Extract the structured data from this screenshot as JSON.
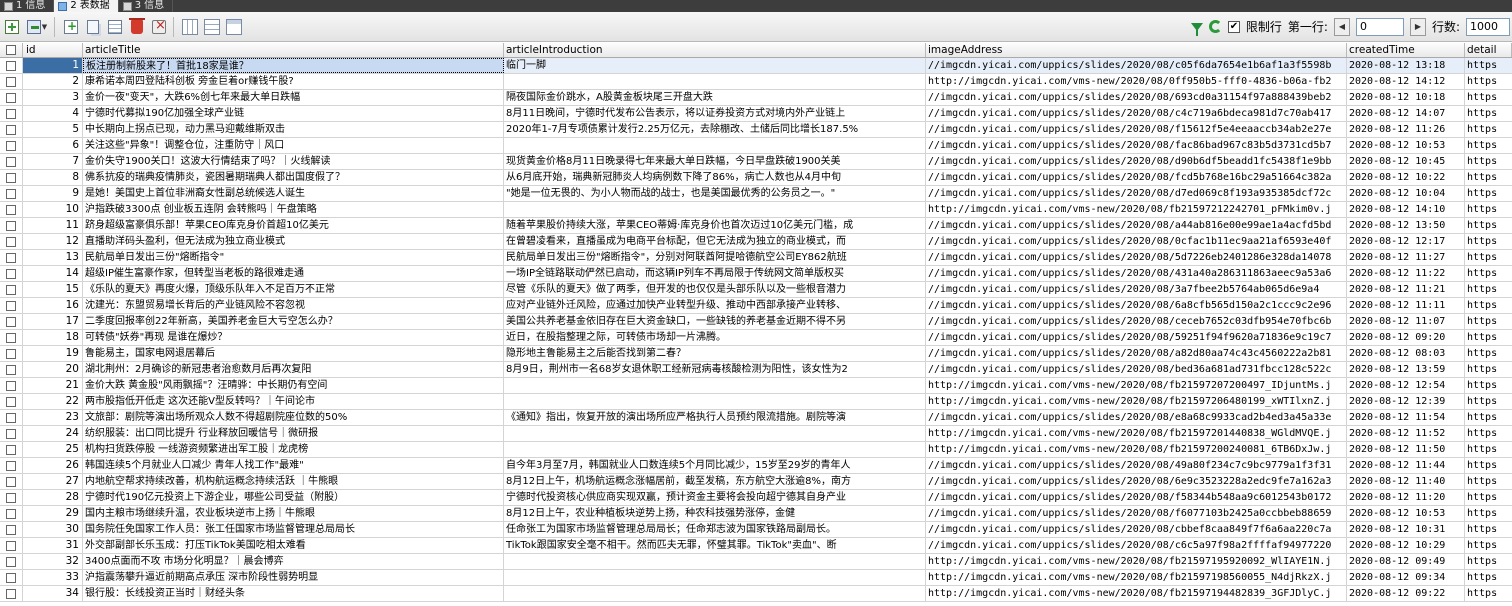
{
  "tabs": [
    {
      "num": "1",
      "label": "信息",
      "active": false
    },
    {
      "num": "2",
      "label": "表数据",
      "active": true
    },
    {
      "num": "3",
      "label": "信息",
      "active": false
    }
  ],
  "toolbar": {
    "limit_label": "限制行",
    "first_row_label": "第一行:",
    "first_row_value": "0",
    "rows_label": "行数:",
    "rows_value": "1000"
  },
  "grid": {
    "columns": [
      "id",
      "articleTitle",
      "articleIntroduction",
      "imageAddress",
      "createdTime",
      "detail"
    ],
    "rows": [
      [
        "1",
        "板注册制新股来了！首批18家是谁？",
        "临门一脚",
        "//imgcdn.yicai.com/uppics/slides/2020/08/c05f6da7654e1b6af1a3f5598b",
        "2020-08-12 13:18",
        "https"
      ],
      [
        "2",
        "康希诺本周四登陆科创板 旁金巨着or赚钱午股?",
        "",
        "http://imgcdn.yicai.com/vms-new/2020/08/0ff950b5-fff0-4836-b06a-fb2",
        "2020-08-12 14:12",
        "https"
      ],
      [
        "3",
        "金价一夜\"变天\"，大跌6%创七年来最大单日跌幅",
        "隔夜国际金价跳水，A股黄金板块尾三开盘大跌",
        "//imgcdn.yicai.com/uppics/slides/2020/08/693cd0a31154f97a888439beb2",
        "2020-08-12 10:18",
        "https"
      ],
      [
        "4",
        "宁德时代募拟190亿加强全球产业链",
        "8月11日晚间，宁德时代发布公告表示，将以证券投资方式对境内外产业链上",
        "//imgcdn.yicai.com/uppics/slides/2020/08/c4c719a6bdeca981d7c70ab417",
        "2020-08-12 14:07",
        "https"
      ],
      [
        "5",
        "中长期向上拐点已现，动力黑马迎戴维斯双击",
        "2020年1-7月专项债累计发行2.25万亿元，去除棚改、土储后同比增长187.5%",
        "//imgcdn.yicai.com/uppics/slides/2020/08/f15612f5e4eeaaccb34ab2e27e",
        "2020-08-12 11:26",
        "https"
      ],
      [
        "6",
        "关注这些\"异象\"！调整仓位，注重防守｜风口",
        "",
        "//imgcdn.yicai.com/uppics/slides/2020/08/fac86bad967c83b5d3731cd5b7",
        "2020-08-12 10:53",
        "https"
      ],
      [
        "7",
        "金价失守1900关口！这波大行情结束了吗？｜火线解读",
        "现货黄金价格8月11日晚录得七年来最大单日跌幅，今日早盘跌破1900关美",
        "//imgcdn.yicai.com/uppics/slides/2020/08/d90b6df5beadd1fc5438f1e9bb",
        "2020-08-12 10:45",
        "https"
      ],
      [
        "8",
        "佛系抗疫的瑞典疫情肺炎，瓷困暑期瑞典人都出国度假了？",
        "从6月底开始，瑞典新冠肺炎人均病例数下降了86%，病亡人数也从4月中旬",
        "//imgcdn.yicai.com/uppics/slides/2020/08/fcd5b768e16bc29a51664c382a",
        "2020-08-12 10:22",
        "https"
      ],
      [
        "9",
        "是她！美国史上首位非洲裔女性副总统候选人诞生",
        "\"她是一位无畏的、为小人物而战的战士，也是美国最优秀的公务员之一。\"",
        "//imgcdn.yicai.com/uppics/slides/2020/08/d7ed069c8f193a935385dcf72c",
        "2020-08-12 10:04",
        "https"
      ],
      [
        "10",
        "沪指跌破3300点 创业板五连阴 会转熊吗｜午盘策略",
        "",
        "http://imgcdn.yicai.com/vms-new/2020/08/fb21597212242701_pFMkim0v.j",
        "2020-08-12 14:10",
        "https"
      ],
      [
        "11",
        "跻身超级富豪俱乐部！苹果CEO库克身价首超10亿美元",
        "随着苹果股价持续大涨，苹果CEO蒂姆·库克身价也首次迈过10亿美元门槛，成",
        "//imgcdn.yicai.com/uppics/slides/2020/08/a44ab816e00e99ae1a4acfd5bd",
        "2020-08-12 13:50",
        "https"
      ],
      [
        "12",
        "直播助洋码头盈利，但无法成为独立商业模式",
        "在曾碧凌看来，直播虽成为电商平台标配，但它无法成为独立的商业模式，而",
        "//imgcdn.yicai.com/uppics/slides/2020/08/0cfac1b11ec9aa21af6593e40f",
        "2020-08-12 12:17",
        "https"
      ],
      [
        "13",
        "民航局单日发出三份\"熔断指令\"",
        "民航局单日发出三份\"熔断指令\"，分别对阿联酋阿提哈德航空公司EY862航班",
        "//imgcdn.yicai.com/uppics/slides/2020/08/5d7226eb2401286e328da14078",
        "2020-08-12 11:27",
        "https"
      ],
      [
        "14",
        "超级IP催生富豪作家，但转型当老板的路很难走通",
        "一场IP全链路联动俨然已启动，而这辆IP列车不再局限于传统网文简单版权买",
        "//imgcdn.yicai.com/uppics/slides/2020/08/431a40a286311863aeec9a53a6",
        "2020-08-12 11:22",
        "https"
      ],
      [
        "15",
        "《乐队的夏天》再度火爆，顶级乐队年入不足百万不正常",
        "尽管《乐队的夏天》做了两季，但开发的也仅仅是头部乐队以及一些根音潜力",
        "//imgcdn.yicai.com/uppics/slides/2020/08/3a7fbee2b5764ab065d6e9a4",
        "2020-08-12 11:21",
        "https"
      ],
      [
        "16",
        "沈建光：东盟贸易增长背后的产业链风险不容忽视",
        "应对产业链外迁风险，应通过加快产业转型升级、推动中西部承接产业转移、",
        "//imgcdn.yicai.com/uppics/slides/2020/08/6a8cfb565d150a2c1ccc9c2e96",
        "2020-08-12 11:11",
        "https"
      ],
      [
        "17",
        "二季度回报率创22年新高，美国养老金巨大亏空怎么办？",
        "美国公共养老基金依旧存在巨大资金缺口，一些缺钱的养老基金近期不得不另",
        "//imgcdn.yicai.com/uppics/slides/2020/08/ceceb7652c03dfb954e70fbc6b",
        "2020-08-12 11:07",
        "https"
      ],
      [
        "18",
        "可转债\"妖券\"再现 是谁在爆炒？",
        "近日，在股指整理之际，可转债市场却一片沸腾。",
        "//imgcdn.yicai.com/uppics/slides/2020/08/59251f94f9620a71836e9c19c7",
        "2020-08-12 09:20",
        "https"
      ],
      [
        "19",
        "鲁能易主，国家电网退居幕后",
        "隐形地主鲁能易主之后能否找到第二春？",
        "//imgcdn.yicai.com/uppics/slides/2020/08/a82d80aa74c43c4560222a2b81",
        "2020-08-12 08:03",
        "https"
      ],
      [
        "20",
        "湖北荆州：2月确诊的新冠患者治愈数月后再次复阳",
        "8月9日，荆州市一名68岁女退休职工经新冠病毒核酸检测为阳性，该女性为2",
        "//imgcdn.yicai.com/uppics/slides/2020/08/bed36a681ad731fbcc128c522c",
        "2020-08-12 13:59",
        "https"
      ],
      [
        "21",
        "金价大跌 黄金股\"风雨飘摇\"？汪晴骅：中长期仍有空间",
        "",
        "http://imgcdn.yicai.com/vms-new/2020/08/fb21597207200497_IDjuntMs.j",
        "2020-08-12 12:54",
        "https"
      ],
      [
        "22",
        "两市股指低开低走 这次还能V型反转吗？｜午间论市",
        "",
        "http://imgcdn.yicai.com/vms-new/2020/08/fb21597206480199_xWTIlxnZ.j",
        "2020-08-12 12:39",
        "https"
      ],
      [
        "23",
        "文旅部：剧院等演出场所观众人数不得超剧院座位数的50%",
        "《通知》指出，恢复开放的演出场所应严格执行人员预约限流措施。剧院等演",
        "//imgcdn.yicai.com/uppics/slides/2020/08/e8a68c9933cad2b4ed3a45a33e",
        "2020-08-12 11:54",
        "https"
      ],
      [
        "24",
        "纺织服装：出口同比提升 行业释放回暖信号｜微研报",
        "",
        "http://imgcdn.yicai.com/vms-new/2020/08/fb21597201440838_WGldMVQE.j",
        "2020-08-12 11:52",
        "https"
      ],
      [
        "25",
        "机构扫货跌停股 一线游资频繁进出军工股｜龙虎榜",
        "",
        "http://imgcdn.yicai.com/vms-new/2020/08/fb21597200240081_6TB6DxJw.j",
        "2020-08-12 11:50",
        "https"
      ],
      [
        "26",
        "韩国连续5个月就业人口减少 青年人找工作\"最难\"",
        "自今年3月至7月，韩国就业人口数连续5个月同比减少，15岁至29岁的青年人",
        "//imgcdn.yicai.com/uppics/slides/2020/08/49a80f234c7c9bc9779a1f3f31",
        "2020-08-12 11:44",
        "https"
      ],
      [
        "27",
        "内地航空帮求持续改善，机构航运概念持续活跃 ｜牛熊眼",
        "8月12日上午，机场航运概念涨幅居前，截至发稿，东方航空大涨逾8%，南方",
        "//imgcdn.yicai.com/uppics/slides/2020/08/6e9c3523228a2edc9fe7a162a3",
        "2020-08-12 11:40",
        "https"
      ],
      [
        "28",
        "宁德时代190亿元投资上下游企业，哪些公司受益（附股）",
        "宁德时代投资核心供应商实现双赢，预计资金主要将会投向超宁德其自身产业",
        "//imgcdn.yicai.com/uppics/slides/2020/08/f58344b548aa9c6012543b0172",
        "2020-08-12 11:20",
        "https"
      ],
      [
        "29",
        "国内主粮市场继续升温，农业板块逆市上扬｜牛熊眼",
        "8月12日上午，农业种植板块逆势上扬，种农科技强势涨停，金健",
        "//imgcdn.yicai.com/uppics/slides/2020/08/f6077103b2425a0ccbbeb88659",
        "2020-08-12 10:53",
        "https"
      ],
      [
        "30",
        "国务院任免国家工作人员：张工任国家市场监督管理总局局长",
        "任命张工为国家市场监督管理总局局长；任命郑志波为国家铁路局副局长。",
        "//imgcdn.yicai.com/uppics/slides/2020/08/cbbef8caa849f7f6a6aa220c7a",
        "2020-08-12 10:31",
        "https"
      ],
      [
        "31",
        "外交部副部长乐玉成：打压TikTok美国吃相太难看",
        "TikTok跟国家安全毫不相干。然而匹夫无罪，怀璧其罪。TikTok\"卖血\"、断",
        "//imgcdn.yicai.com/uppics/slides/2020/08/c6c5a97f98a2ffffaf94977220",
        "2020-08-12 10:29",
        "https"
      ],
      [
        "32",
        "3400点面而不攻 市场分化明显？｜晨会博弈",
        "",
        "http://imgcdn.yicai.com/vms-new/2020/08/fb21597195920092_WlIAYE1N.j",
        "2020-08-12 09:49",
        "https"
      ],
      [
        "33",
        "沪指震荡攀升逼近前期高点承压 深市阶段性弱势明显",
        "",
        "http://imgcdn.yicai.com/vms-new/2020/08/fb21597198560055_N4djRkzX.j",
        "2020-08-12 09:34",
        "https"
      ],
      [
        "34",
        "银行股：长线投资正当时｜财经头条",
        "",
        "http://imgcdn.yicai.com/vms-new/2020/08/fb21597194482839_3GFJDlyC.j",
        "2020-08-12 09:22",
        "https"
      ]
    ]
  }
}
